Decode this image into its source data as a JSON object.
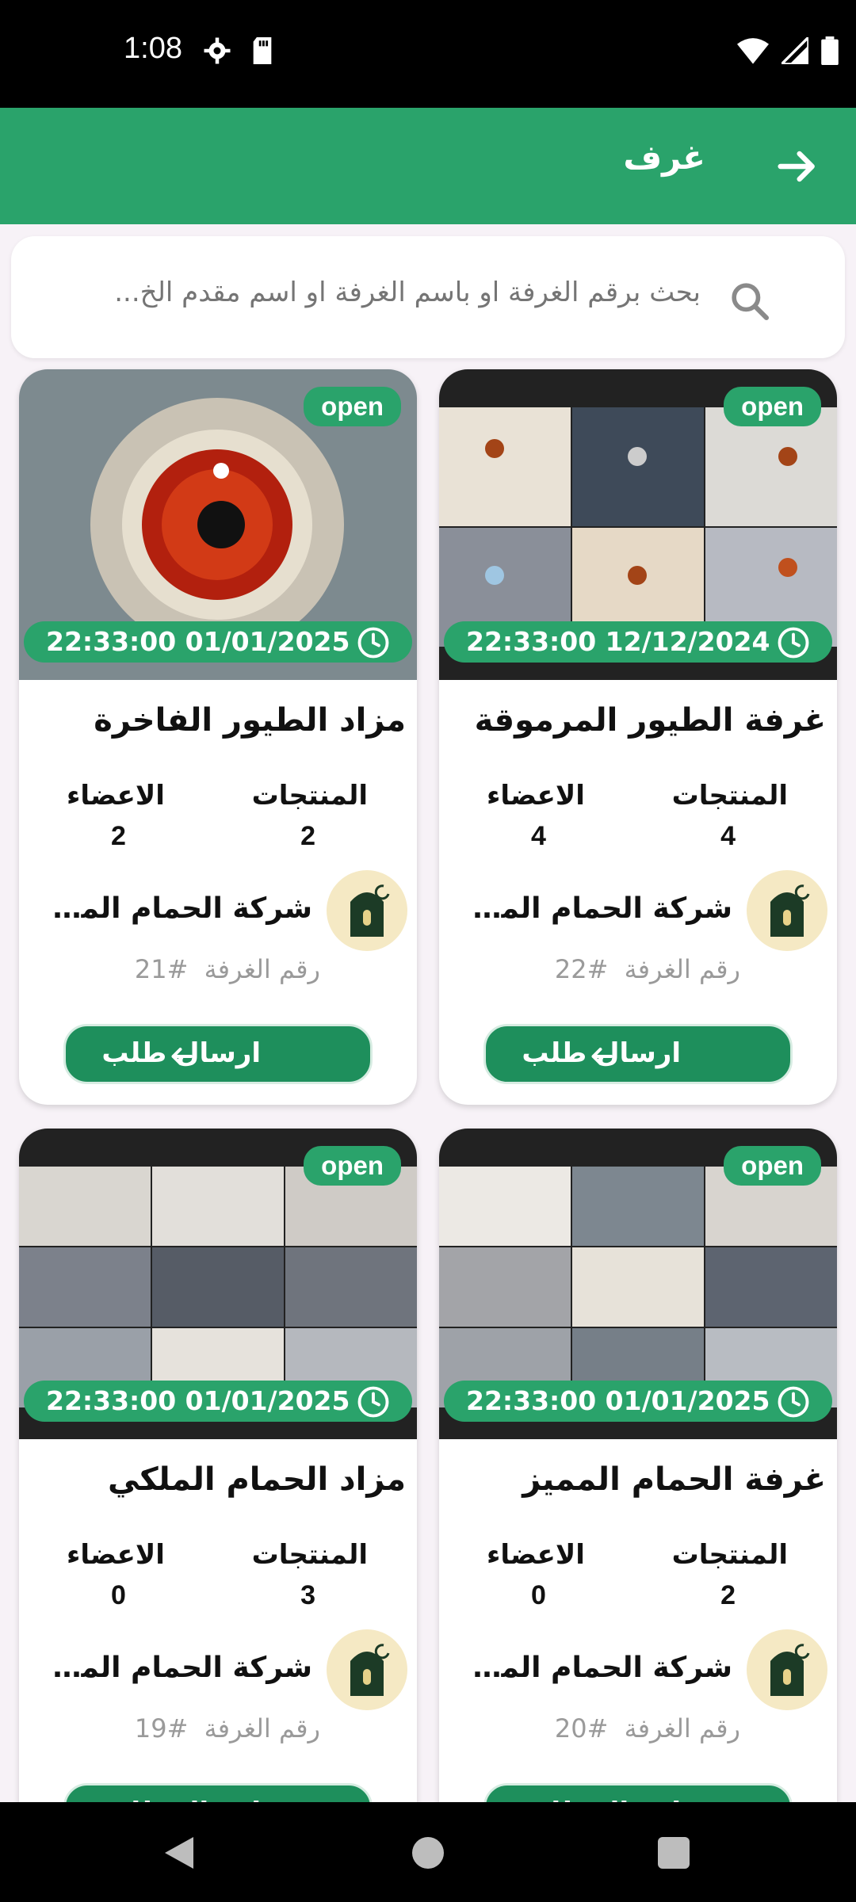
{
  "status_bar": {
    "time": "1:08"
  },
  "app_bar": {
    "title": "غرف"
  },
  "search": {
    "placeholder": "بحث برقم الغرفة او باسم الغرفة او اسم مقدم الخ..."
  },
  "labels": {
    "products": "المنتجات",
    "members": "الاعضاء",
    "send_request": "ارسال طلب",
    "room_label": "رقم  الغرفة",
    "open": "open"
  },
  "colors": {
    "primary": "#2aa36b",
    "button": "#1e8f5c"
  },
  "rooms": [
    {
      "title": "مزاد الطيور الفاخرة",
      "status": "open",
      "datetime": "22:33:00 01/01/2025",
      "products": "2",
      "members": "2",
      "company": "شركة الحمام المصري",
      "room_no": "#21"
    },
    {
      "title": "غرفة الطيور المرموقة",
      "status": "open",
      "datetime": "22:33:00 12/12/2024",
      "products": "4",
      "members": "4",
      "company": "شركة الحمام المصري",
      "room_no": "#22"
    },
    {
      "title": "مزاد الحمام الملكي",
      "status": "open",
      "datetime": "22:33:00 01/01/2025",
      "products": "3",
      "members": "0",
      "company": "شركة الحمام المصري",
      "room_no": "#19"
    },
    {
      "title": "غرفة الحمام المميز",
      "status": "open",
      "datetime": "22:33:00 01/01/2025",
      "products": "2",
      "members": "0",
      "company": "شركة الحمام المصري",
      "room_no": "#20"
    }
  ]
}
